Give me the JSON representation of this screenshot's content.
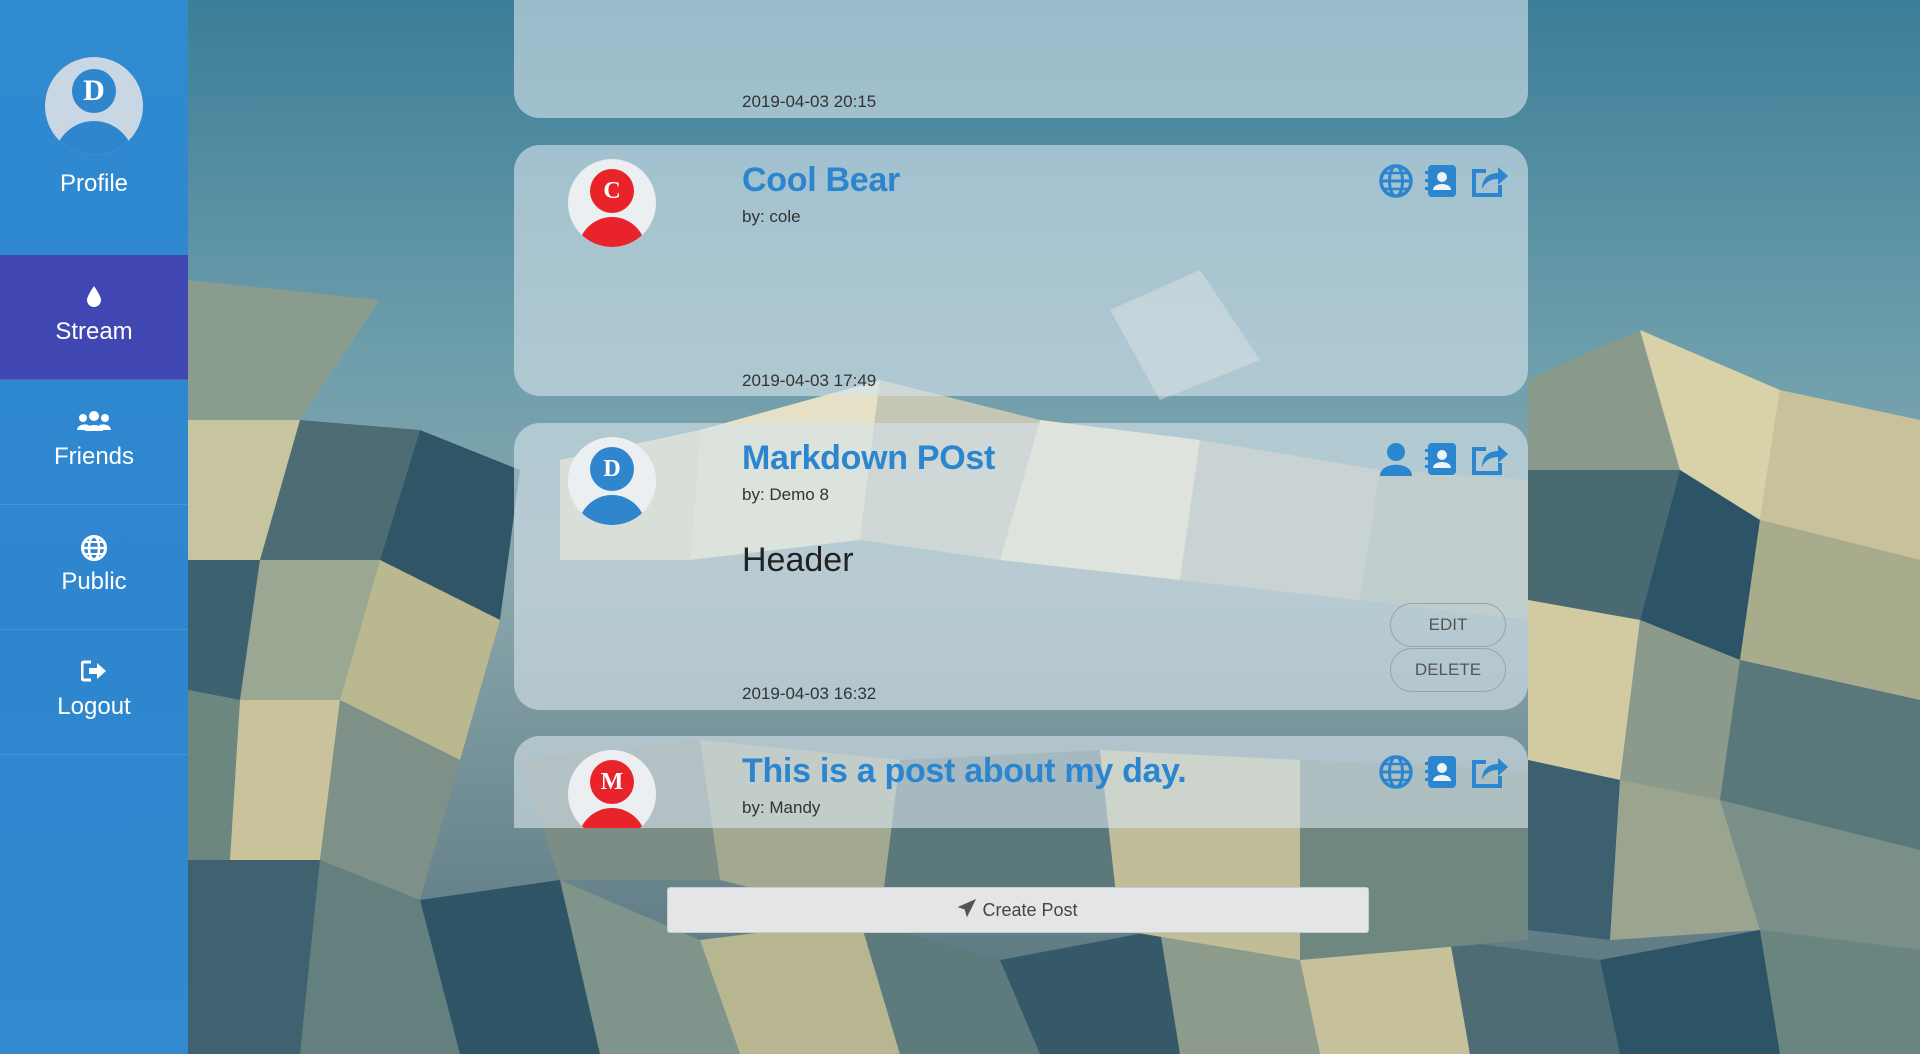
{
  "sidebar": {
    "profile": {
      "initial": "D",
      "label": "Profile"
    },
    "items": [
      {
        "label": "Stream",
        "icon": "tint-icon",
        "active": true
      },
      {
        "label": "Friends",
        "icon": "users-icon",
        "active": false
      },
      {
        "label": "Public",
        "icon": "globe-icon",
        "active": false
      },
      {
        "label": "Logout",
        "icon": "sign-out-icon",
        "active": false
      }
    ]
  },
  "posts": [
    {
      "date": "2019-04-03 20:15"
    },
    {
      "initial": "C",
      "avatar_color": "#e8232a",
      "title": "Cool Bear",
      "author": "by: cole",
      "visibility_icon": "globe-icon",
      "date": "2019-04-03 17:49"
    },
    {
      "initial": "D",
      "avatar_color": "#2f86cd",
      "title": "Markdown POst",
      "author": "by: Demo 8",
      "visibility_icon": "user-icon",
      "content": "Header",
      "date": "2019-04-03 16:32",
      "edit_label": "EDIT",
      "delete_label": "DELETE"
    },
    {
      "initial": "M",
      "avatar_color": "#e8232a",
      "title": "This is a post about my day.",
      "author": "by: Mandy",
      "visibility_icon": "globe-icon"
    }
  ],
  "create_post_label": "Create Post",
  "colors": {
    "accent": "#2b86cf",
    "sidebar": "#2f8ad0",
    "active_nav": "#4047b3"
  }
}
